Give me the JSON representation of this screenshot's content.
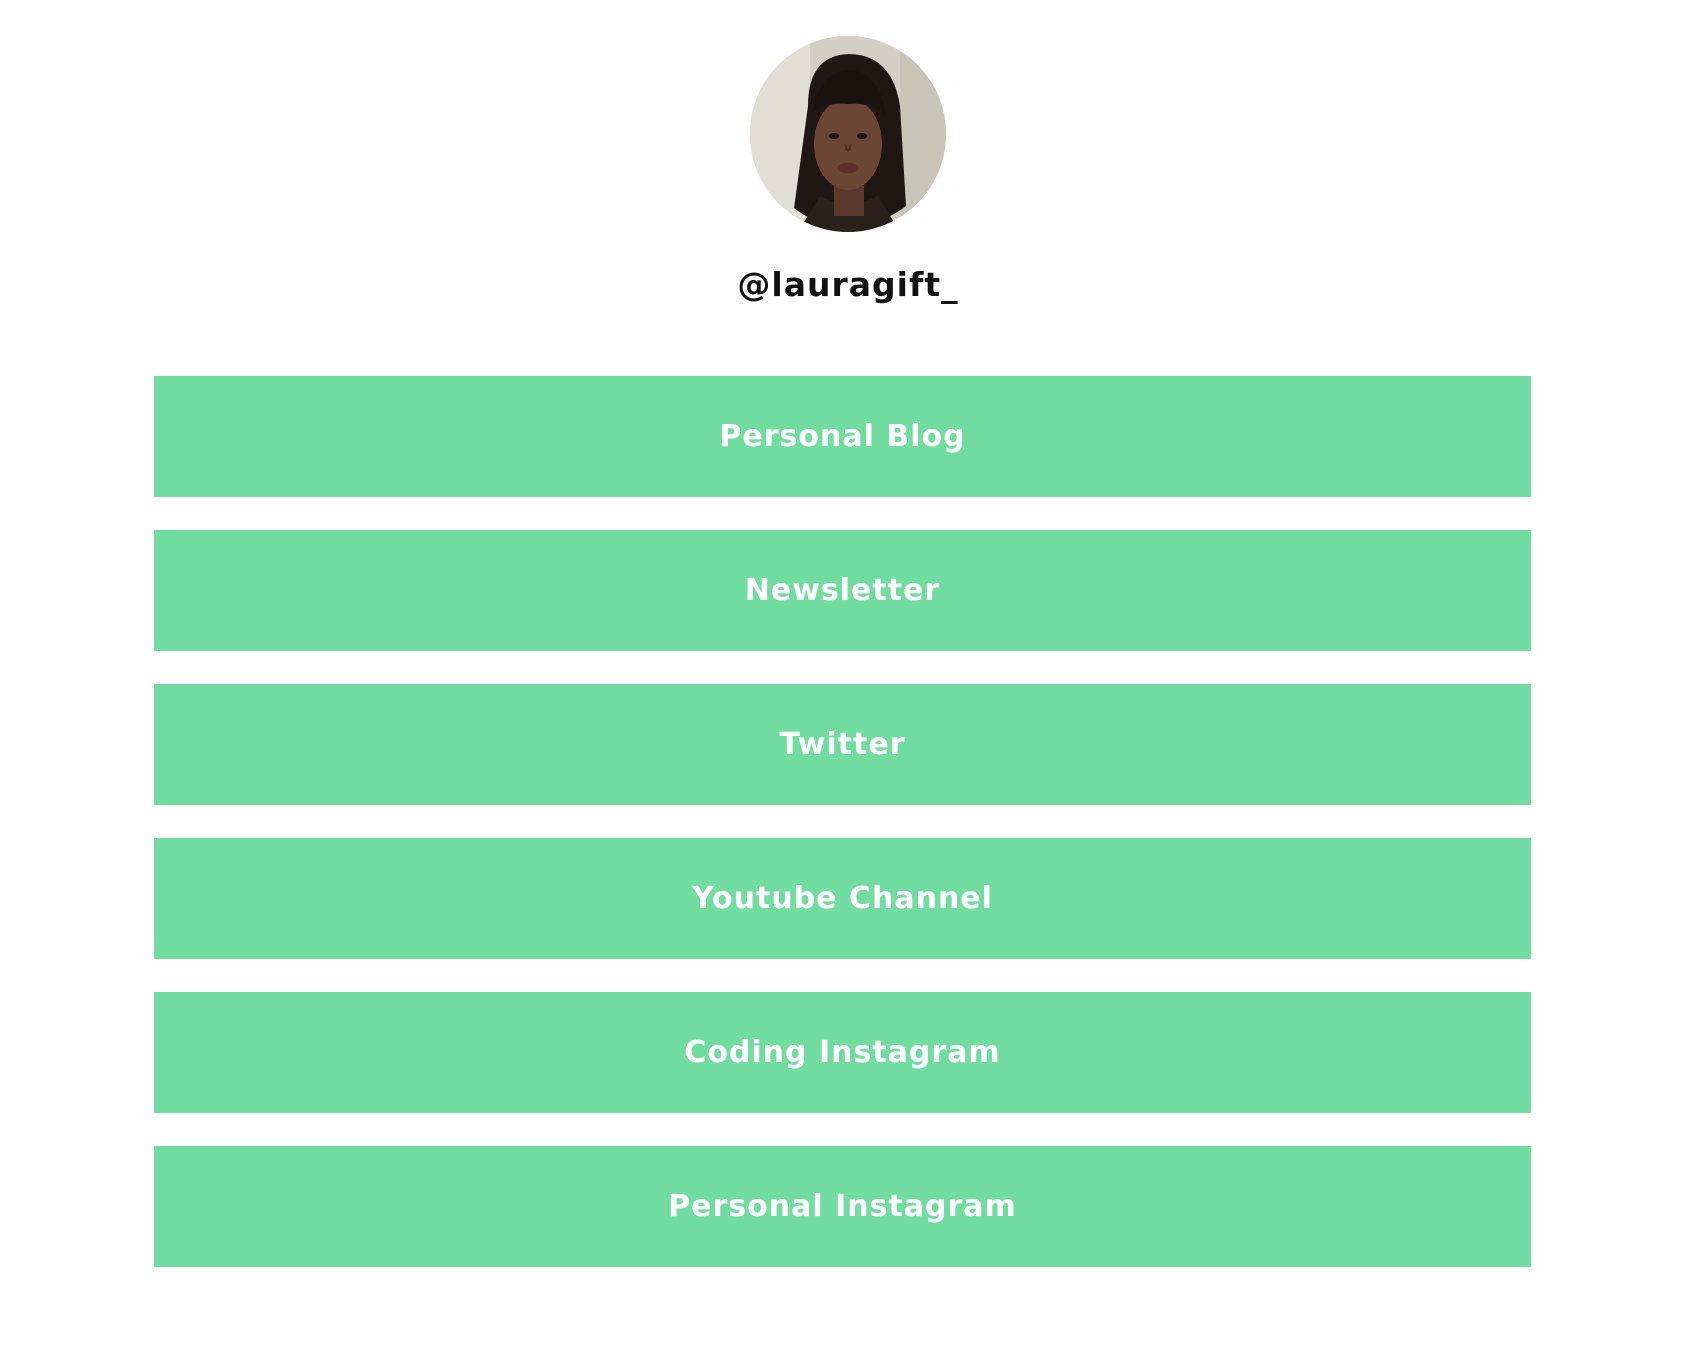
{
  "profile": {
    "username": "@lauragift_",
    "avatar_icon": "profile-photo"
  },
  "theme": {
    "button_color": "#71dc9f",
    "button_text_color": "#ffffff",
    "background": "#ffffff"
  },
  "links": [
    {
      "label": "Personal Blog"
    },
    {
      "label": "Newsletter"
    },
    {
      "label": "Twitter"
    },
    {
      "label": "Youtube Channel"
    },
    {
      "label": "Coding Instagram"
    },
    {
      "label": "Personal Instagram"
    }
  ]
}
